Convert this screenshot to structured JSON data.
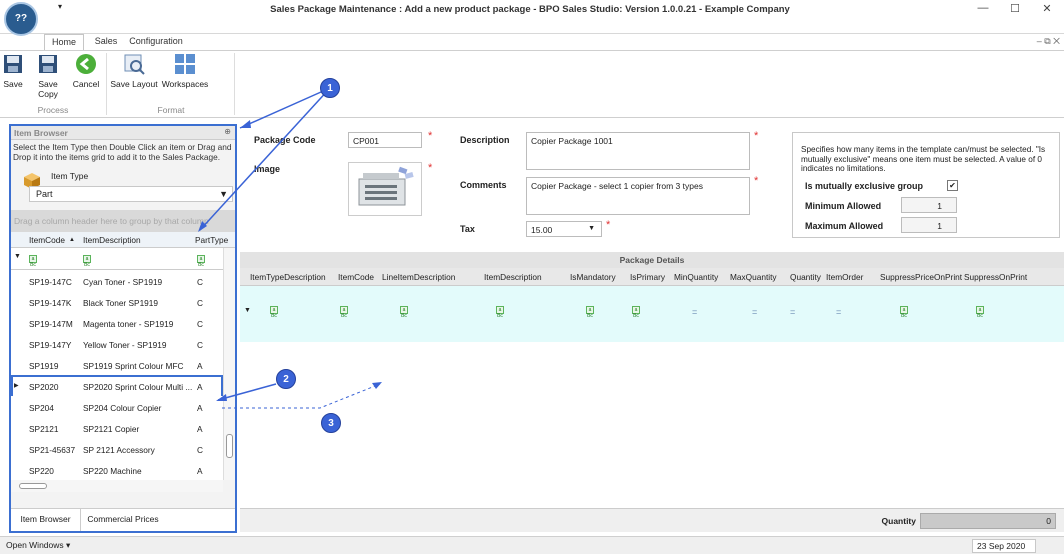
{
  "window": {
    "title": "Sales Package Maintenance : Add a new product package - BPO Sales Studio: Version 1.0.0.21 - Example Company",
    "qat_glyph": "▾",
    "logo_text": "??",
    "min_glyph": "—",
    "max_glyph": "☐",
    "close_glyph": "✕",
    "ribbon_min_glyph": "–  ⧉  ✕"
  },
  "tabs": [
    "Home",
    "Sales",
    "Configuration"
  ],
  "ribbon": {
    "buttons": [
      "Save",
      "Save Copy",
      "Cancel",
      "Save Layout",
      "Workspaces"
    ],
    "groups": [
      "Process",
      "Format"
    ]
  },
  "item_browser": {
    "title": "Item Browser",
    "pin_glyph": "⊕",
    "instructions": "Select the Item Type then Double Click an item or Drag and Drop it into the items grid to add it to the Sales Package.",
    "item_type_label": "Item Type",
    "item_type_value": "Part",
    "group_hint": "Drag a column header here to group by that column",
    "columns": [
      "ItemCode",
      "ItemDescription",
      "PartType"
    ],
    "sort_glyph": "▲",
    "filter_glyph": "▼",
    "filter_cell_text": "a​B​c",
    "row_pointer": "▶",
    "rows": [
      {
        "code": "SP19-147C",
        "desc": "Cyan Toner - SP1919",
        "type": "C"
      },
      {
        "code": "SP19-147K",
        "desc": "Black Toner SP1919",
        "type": "C"
      },
      {
        "code": "SP19-147M",
        "desc": "Magenta toner - SP1919",
        "type": "C"
      },
      {
        "code": "SP19-147Y",
        "desc": "Yellow Toner - SP1919",
        "type": "C"
      },
      {
        "code": "SP1919",
        "desc": "SP1919 Sprint Colour MFC",
        "type": "A"
      },
      {
        "code": "SP2020",
        "desc": "SP2020 Sprint Colour Multi ...",
        "type": "A"
      },
      {
        "code": "SP204",
        "desc": "SP204 Colour Copier",
        "type": "A"
      },
      {
        "code": "SP2121",
        "desc": "SP2121 Copier",
        "type": "A"
      },
      {
        "code": "SP21-45637",
        "desc": "SP 2121 Accessory",
        "type": "C"
      },
      {
        "code": "SP220",
        "desc": "SP220 Machine",
        "type": "A"
      }
    ],
    "selected_index": 5,
    "bottom_tabs": [
      "Item Browser",
      "Commercial Prices"
    ]
  },
  "form": {
    "package_code_label": "Package Code",
    "package_code_value": "CP001",
    "image_label": "Image",
    "description_label": "Description",
    "description_value": "Copier Package 1001",
    "comments_label": "Comments",
    "comments_value": "Copier Package - select 1 copier from 3 types",
    "tax_label": "Tax",
    "tax_value": "15.00",
    "required_marker": "*",
    "hint": "Specifies how many items in the template can/must be selected. \"Is mutually exclusive\" means one item must be selected. A value of 0 indicates no limitations.",
    "mutually_exclusive_label": "Is mutually exclusive group",
    "mutually_exclusive_checked": true,
    "checkmark": "✔",
    "min_label": "Minimum Allowed",
    "min_value": "1",
    "max_label": "Maximum Allowed",
    "max_value": "1"
  },
  "package_details": {
    "title": "Package Details",
    "columns": [
      "ItemTypeDescription",
      "ItemCode",
      "LineItemDescription",
      "ItemDescription",
      "IsMandatory",
      "IsPrimary",
      "MinQuantity",
      "MaxQuantity",
      "Quantity",
      "ItemOrder",
      "SuppressPriceOnPrint",
      "SuppressOnPrint"
    ],
    "equals_glyph": "="
  },
  "quantity_label": "Quantity",
  "quantity_value": "0",
  "status": {
    "open_windows": "Open Windows ▾",
    "date": "23 Sep 2020"
  },
  "callouts": [
    "1",
    "2",
    "3"
  ],
  "colors": {
    "accent": "#3b6fd1",
    "callout": "#3a63d6",
    "detail_row": "#e3fbfb"
  }
}
